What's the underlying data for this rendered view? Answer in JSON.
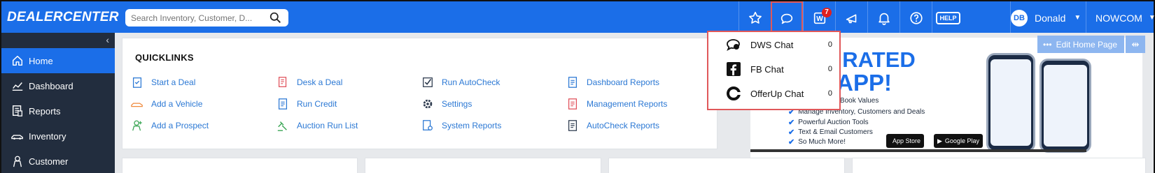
{
  "header": {
    "logo": "DEALERCENTER",
    "search_placeholder": "Search Inventory, Customer, D...",
    "notification_count": "7",
    "help_label": "HELP",
    "user_initials": "DB",
    "user_name": "Donald",
    "company": "NOWCOM",
    "icons": [
      "star-icon",
      "chat-icon",
      "w-icon",
      "megaphone-icon",
      "bell-icon",
      "question-icon",
      "help-icon"
    ],
    "accent": "#1b6ee8"
  },
  "sidebar": {
    "items": [
      {
        "label": "Home",
        "icon": "home-icon"
      },
      {
        "label": "Dashboard",
        "icon": "chart-icon"
      },
      {
        "label": "Reports",
        "icon": "reports-icon"
      },
      {
        "label": "Inventory",
        "icon": "car-icon"
      },
      {
        "label": "Customer",
        "icon": "person-icon"
      }
    ]
  },
  "quicklinks": {
    "title": "QUICKLINKS",
    "columns": [
      [
        "Start a Deal",
        "Add a Vehicle",
        "Add a Prospect"
      ],
      [
        "Desk a Deal",
        "Run Credit",
        "Auction Run List"
      ],
      [
        "Run AutoCheck",
        "Settings",
        "System Reports"
      ],
      [
        "Dashboard Reports",
        "Management Reports",
        "AutoCheck Reports"
      ]
    ]
  },
  "banner": {
    "headline1": "BEST RATED",
    "headline2": "BILE APP!",
    "bullets": [
      "istory Reports & Book Values",
      "Manage Inventory, Customers and Deals",
      "Powerful Auction Tools",
      "Text & Email Customers",
      "So Much More!"
    ],
    "app_store": "App Store",
    "google_play": "Google Play"
  },
  "edit_home": "Edit Home Page",
  "chat_menu": {
    "items": [
      {
        "label": "DWS Chat",
        "count": "0"
      },
      {
        "label": "FB Chat",
        "count": "0"
      },
      {
        "label": "OfferUp Chat",
        "count": "0"
      }
    ]
  }
}
